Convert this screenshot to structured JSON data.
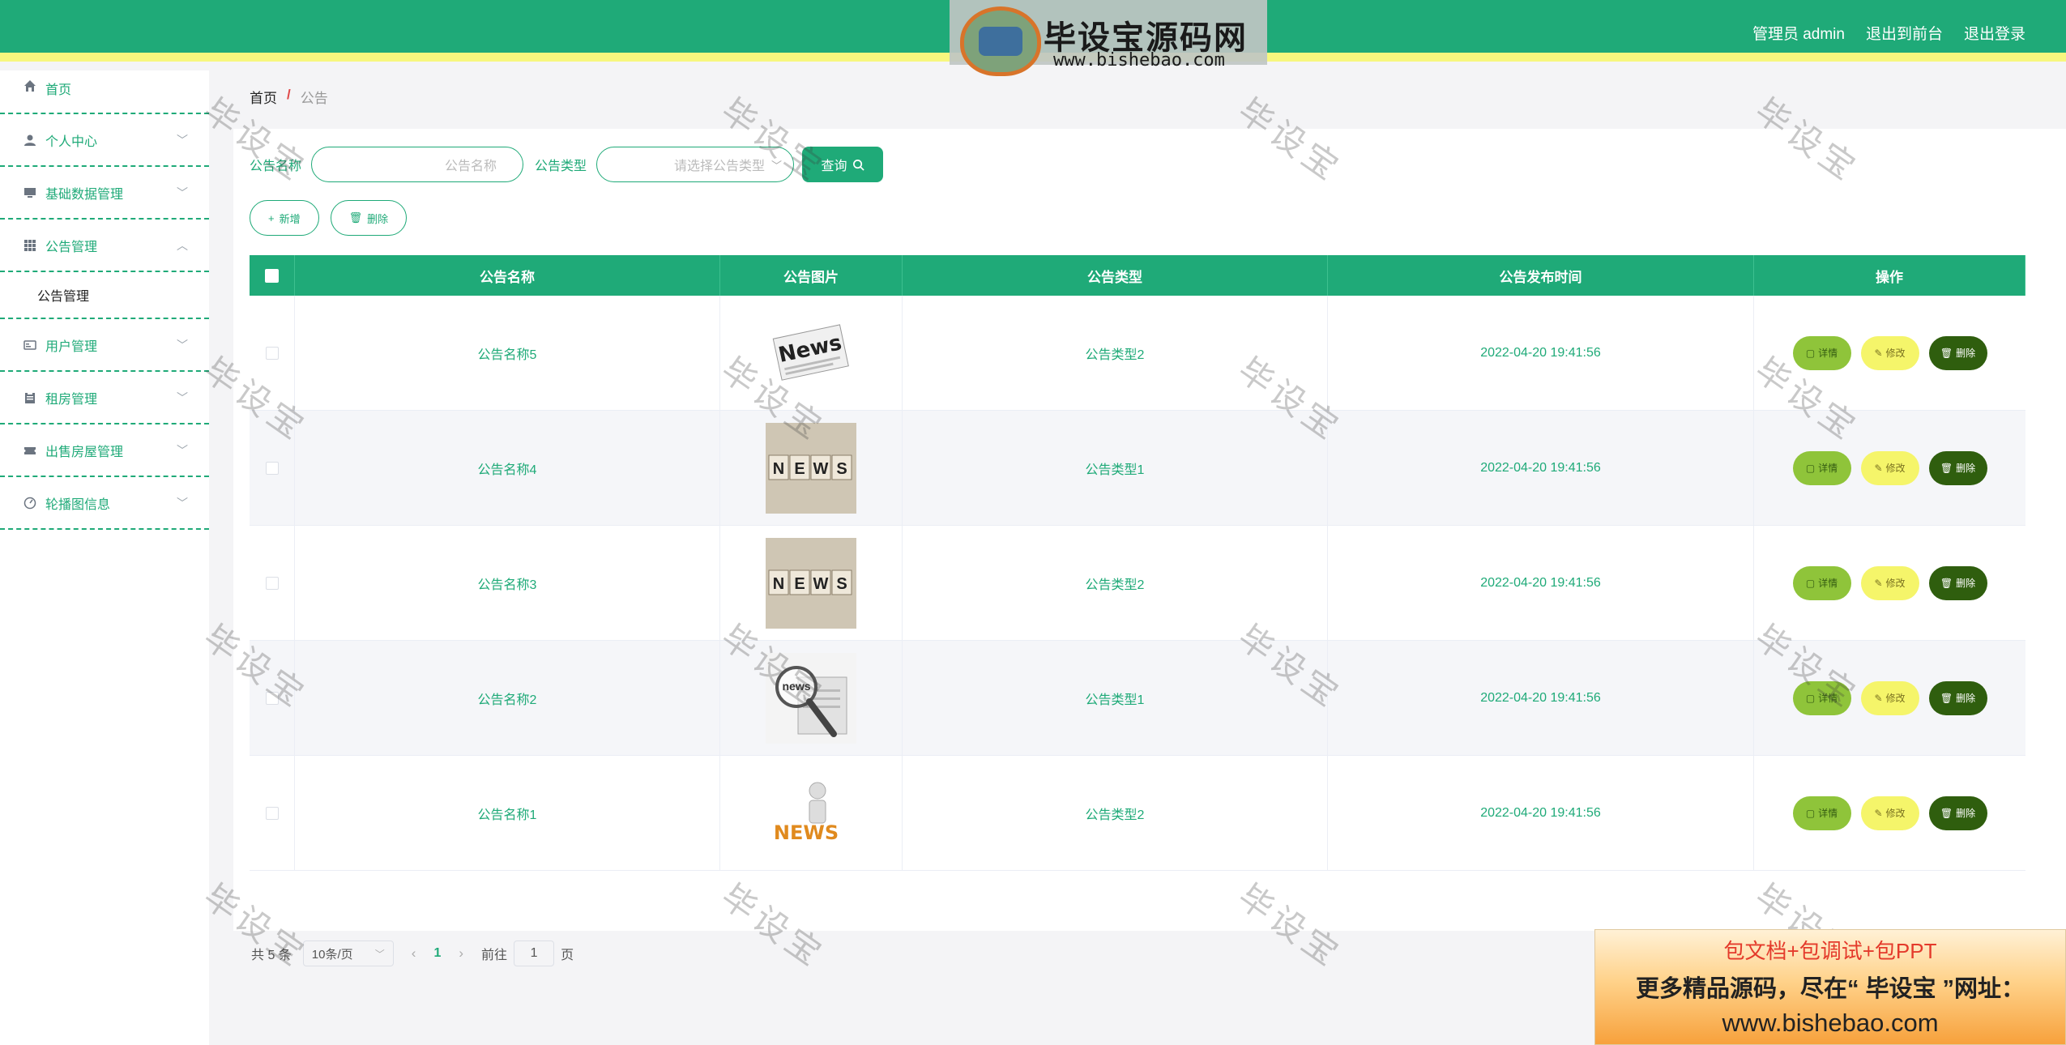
{
  "header": {
    "logo_text": "毕设宝源码网",
    "logo_url": "www.bishebao.com",
    "user_label": "管理员 admin",
    "front_link": "退出到前台",
    "logout_link": "退出登录"
  },
  "sidebar": {
    "items": [
      {
        "label": "首页",
        "icon": "home-icon"
      },
      {
        "label": "个人中心",
        "icon": "user-icon"
      },
      {
        "label": "基础数据管理",
        "icon": "monitor-icon"
      },
      {
        "label": "公告管理",
        "icon": "grid-icon"
      },
      {
        "label": "用户管理",
        "icon": "id-card-icon"
      },
      {
        "label": "租房管理",
        "icon": "clipboard-icon"
      },
      {
        "label": "出售房屋管理",
        "icon": "ticket-icon"
      },
      {
        "label": "轮播图信息",
        "icon": "dashboard-icon"
      }
    ],
    "submenu": {
      "label": "公告管理"
    }
  },
  "breadcrumb": {
    "home": "首页",
    "separator": "/",
    "current": "公告"
  },
  "search": {
    "name_label": "公告名称",
    "name_placeholder": "公告名称",
    "type_label": "公告类型",
    "type_placeholder": "请选择公告类型",
    "query_button": "查询"
  },
  "actions": {
    "add": "新增",
    "delete": "删除"
  },
  "table": {
    "columns": [
      "公告名称",
      "公告图片",
      "公告类型",
      "公告发布时间",
      "操作"
    ],
    "rows": [
      {
        "name": "公告名称5",
        "image": "news-paper-image",
        "type": "公告类型2",
        "time": "2022-04-20 19:41:56"
      },
      {
        "name": "公告名称4",
        "image": "news-blocks-image",
        "type": "公告类型1",
        "time": "2022-04-20 19:41:56"
      },
      {
        "name": "公告名称3",
        "image": "news-blocks-image",
        "type": "公告类型2",
        "time": "2022-04-20 19:41:56"
      },
      {
        "name": "公告名称2",
        "image": "news-magnifier-image",
        "type": "公告类型1",
        "time": "2022-04-20 19:41:56"
      },
      {
        "name": "公告名称1",
        "image": "news-3d-figure-image",
        "type": "公告类型2",
        "time": "2022-04-20 19:41:56"
      }
    ],
    "ops": {
      "detail": "详情",
      "edit": "修改",
      "delete": "删除"
    }
  },
  "pagination": {
    "total": "共 5 条",
    "page_size": "10条/页",
    "current_page": "1",
    "goto_prefix": "前往",
    "goto_value": "1",
    "goto_suffix": "页"
  },
  "watermark": "毕设宝",
  "promo": {
    "line1": "包文档+包调试+包PPT",
    "line2": "更多精品源码，尽在“ 毕设宝 ”网址：",
    "line3": "www.bishebao.com"
  },
  "colors": {
    "primary": "#1faa78",
    "header_stripe": "#f7f77e",
    "detail_btn": "#8fc43a",
    "edit_btn": "#f5f56a",
    "delete_btn": "#2f5e0e"
  }
}
